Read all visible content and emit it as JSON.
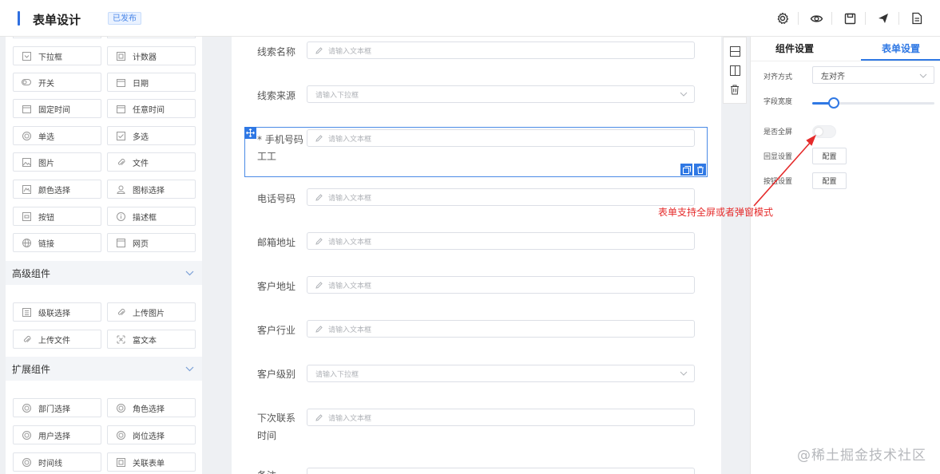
{
  "header": {
    "title": "表单设计",
    "badge": "已发布",
    "icons": [
      "gear-icon",
      "eye-icon",
      "save-icon",
      "send-icon",
      "document-icon"
    ]
  },
  "palette": {
    "basic_items": [
      {
        "label": "下拉框",
        "icon": "dropdown-icon"
      },
      {
        "label": "计数器",
        "icon": "counter-icon"
      },
      {
        "label": "开关",
        "icon": "switch-icon"
      },
      {
        "label": "日期",
        "icon": "calendar-icon"
      },
      {
        "label": "固定时间",
        "icon": "calendar-icon"
      },
      {
        "label": "任意时间",
        "icon": "calendar-icon"
      },
      {
        "label": "单选",
        "icon": "radio-icon"
      },
      {
        "label": "多选",
        "icon": "checkbox-icon"
      },
      {
        "label": "图片",
        "icon": "image-icon"
      },
      {
        "label": "文件",
        "icon": "attachment-icon"
      },
      {
        "label": "颜色选择",
        "icon": "palette-icon"
      },
      {
        "label": "图标选择",
        "icon": "user-icon"
      },
      {
        "label": "按钮",
        "icon": "button-icon"
      },
      {
        "label": "描述框",
        "icon": "info-icon"
      },
      {
        "label": "链接",
        "icon": "globe-icon"
      },
      {
        "label": "网页",
        "icon": "webpage-icon"
      }
    ],
    "advanced_title": "高级组件",
    "advanced_items": [
      {
        "label": "级联选择",
        "icon": "cascade-icon"
      },
      {
        "label": "上传图片",
        "icon": "attachment-icon"
      },
      {
        "label": "上传文件",
        "icon": "attachment-icon"
      },
      {
        "label": "富文本",
        "icon": "richtext-icon"
      }
    ],
    "extended_title": "扩展组件",
    "extended_items": [
      {
        "label": "部门选择",
        "icon": "radio-icon"
      },
      {
        "label": "角色选择",
        "icon": "radio-icon"
      },
      {
        "label": "用户选择",
        "icon": "radio-icon"
      },
      {
        "label": "岗位选择",
        "icon": "radio-icon"
      },
      {
        "label": "时间线",
        "icon": "radio-icon"
      },
      {
        "label": "关联表单",
        "icon": "form-link-icon"
      }
    ]
  },
  "canvas": {
    "fields": [
      {
        "label": "线索名称",
        "placeholder": "请输入文本框",
        "type": "input"
      },
      {
        "label": "线索来源",
        "placeholder": "请输入下拉框",
        "type": "select"
      },
      {
        "label": "* 手机号码",
        "label_line2": "工工",
        "placeholder": "请输入文本框",
        "type": "input",
        "selected": true
      },
      {
        "label": "电话号码",
        "placeholder": "请输入文本框",
        "type": "input"
      },
      {
        "label": "邮箱地址",
        "placeholder": "请输入文本框",
        "type": "input"
      },
      {
        "label": "客户地址",
        "placeholder": "请输入文本框",
        "type": "input"
      },
      {
        "label": "客户行业",
        "placeholder": "请输入文本框",
        "type": "input"
      },
      {
        "label": "客户级别",
        "placeholder": "请输入下拉框",
        "type": "select"
      },
      {
        "label": "下次联系",
        "label_line2": "时间",
        "placeholder": "请输入文本框",
        "type": "input"
      },
      {
        "label": "备注",
        "placeholder": "",
        "type": "input"
      }
    ]
  },
  "right_panel": {
    "tabs": [
      "组件设置",
      "表单设置"
    ],
    "active_tab": "表单设置",
    "align_label": "对齐方式",
    "align_value": "左对齐",
    "width_label": "字段宽度",
    "width_value": 0.18,
    "fullscreen_label": "是否全屏",
    "fullscreen_on": false,
    "echo_label": "回显设置",
    "echo_button": "配置",
    "button_label": "按钮设置",
    "button_button": "配置"
  },
  "annotation": "表单支持全屏或者弹窗模式",
  "watermark": "@稀土掘金技术社区",
  "colors": {
    "accent": "#2f78e4",
    "annotation": "#e52b2b"
  }
}
